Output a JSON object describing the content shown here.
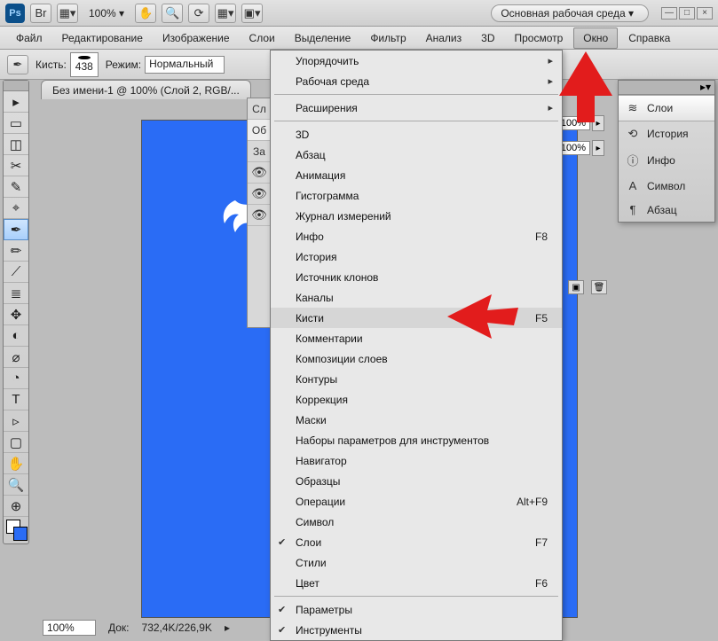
{
  "titlebar": {
    "ps_logo": "Ps",
    "zoom": "100% ▾"
  },
  "workspace": {
    "label": "Основная рабочая среда ▾"
  },
  "menubar": {
    "items": [
      "Файл",
      "Редактирование",
      "Изображение",
      "Слои",
      "Выделение",
      "Фильтр",
      "Анализ",
      "3D",
      "Просмотр",
      "Окно",
      "Справка"
    ],
    "active_index": 9
  },
  "optionsbar": {
    "brush_label": "Кисть:",
    "brush_size": "438",
    "mode_label": "Режим:",
    "mode_value": "Нормальный"
  },
  "document": {
    "tab_title": "Без имени-1 @ 100% (Слой 2, RGB/..."
  },
  "right_opacity": {
    "value1": "100%",
    "value2": "100%"
  },
  "float_panel": {
    "items": [
      {
        "icon": "≋",
        "label": "Слои"
      },
      {
        "icon": "⟲",
        "label": "История"
      },
      {
        "icon": "ⓘ",
        "label": "Инфо"
      },
      {
        "icon": "A",
        "label": "Символ"
      },
      {
        "icon": "¶",
        "label": "Абзац"
      }
    ],
    "selected_index": 0
  },
  "dropdown": {
    "groups": [
      [
        {
          "label": "Упорядочить",
          "sub": true
        },
        {
          "label": "Рабочая среда",
          "sub": true
        }
      ],
      [
        {
          "label": "Расширения",
          "sub": true
        }
      ],
      [
        {
          "label": "3D"
        },
        {
          "label": "Абзац"
        },
        {
          "label": "Анимация"
        },
        {
          "label": "Гистограмма"
        },
        {
          "label": "Журнал измерений"
        },
        {
          "label": "Инфо",
          "shortcut": "F8"
        },
        {
          "label": "История"
        },
        {
          "label": "Источник клонов"
        },
        {
          "label": "Каналы"
        },
        {
          "label": "Кисти",
          "shortcut": "F5",
          "highlight": true
        },
        {
          "label": "Комментарии"
        },
        {
          "label": "Композиции слоев"
        },
        {
          "label": "Контуры"
        },
        {
          "label": "Коррекция"
        },
        {
          "label": "Маски"
        },
        {
          "label": "Наборы параметров для инструментов"
        },
        {
          "label": "Навигатор"
        },
        {
          "label": "Образцы"
        },
        {
          "label": "Операции",
          "shortcut": "Alt+F9"
        },
        {
          "label": "Символ"
        },
        {
          "label": "Слои",
          "shortcut": "F7",
          "checked": true
        },
        {
          "label": "Стили"
        },
        {
          "label": "Цвет",
          "shortcut": "F6"
        }
      ],
      [
        {
          "label": "Параметры",
          "checked": true
        },
        {
          "label": "Инструменты",
          "checked": true
        }
      ]
    ]
  },
  "layers_slice": {
    "rows": [
      "Сл",
      "Об",
      "За"
    ]
  },
  "statusbar": {
    "zoom": "100%",
    "doc_label": "Док:",
    "doc_value": "732,4K/226,9K"
  },
  "tool_icons": [
    "▸",
    "▭",
    "◫",
    "✂",
    "✎",
    "⌖",
    "✒",
    "✏",
    "⟋",
    "≣",
    "✥",
    "◐",
    "⌀",
    "◔",
    "✧",
    "T",
    "▹",
    "▢",
    "✋",
    "🔍",
    "⊕"
  ]
}
